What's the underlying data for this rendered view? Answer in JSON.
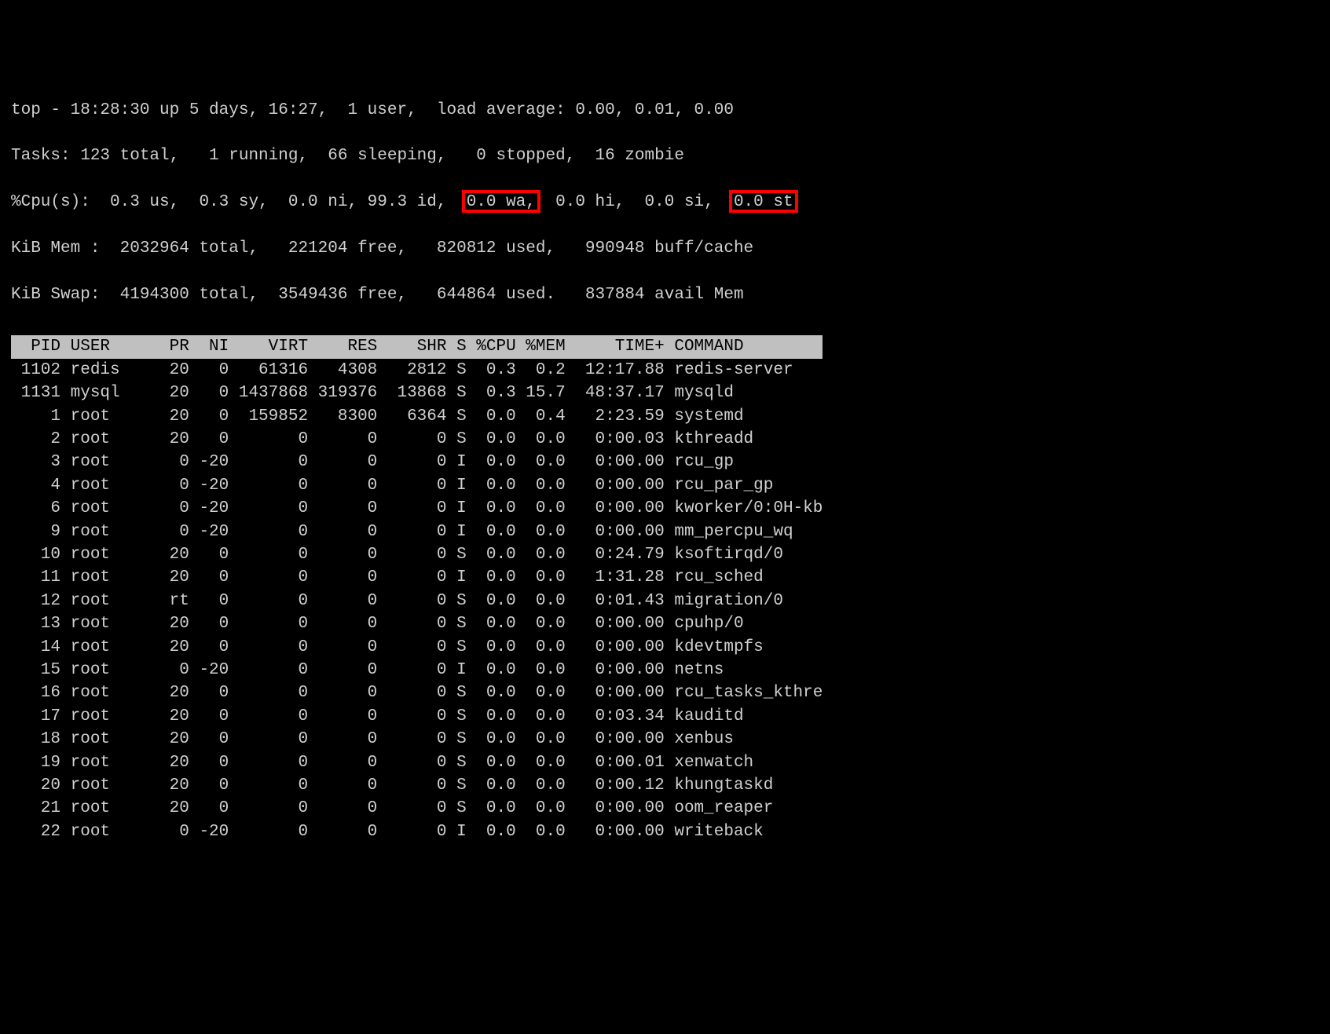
{
  "top_header": {
    "line1": "top - 18:28:30 up 5 days, 16:27,  1 user,  load average: 0.00, 0.01, 0.00",
    "line2": "Tasks: 123 total,   1 running,  66 sleeping,   0 stopped,  16 zombie",
    "line3": "%Cpu(s):  0.3 us,  0.3 sy,  0.0 ni, 99.3 id,  0.0 wa,  0.0 hi,  0.0 si,  0.0 st",
    "line4": "KiB Mem :  2032964 total,   221204 free,   820812 used,   990948 buff/cache",
    "line5": "KiB Swap:  4194300 total,  3549436 free,   644864 used.   837884 avail Mem"
  },
  "columns_header": "  PID USER      PR  NI    VIRT    RES    SHR S %CPU %MEM     TIME+ COMMAND        ",
  "processes": [
    {
      "row": " 1102 redis     20   0   61316   4308   2812 S  0.3  0.2  12:17.88 redis-server",
      "pid": 1102,
      "user": "redis",
      "pr": "20",
      "ni": "0",
      "virt": "61316",
      "res": "4308",
      "shr": "2812",
      "s": "S",
      "cpu": "0.3",
      "mem": "0.2",
      "time": "12:17.88",
      "command": "redis-server"
    },
    {
      "row": " 1131 mysql     20   0 1437868 319376  13868 S  0.3 15.7  48:37.17 mysqld",
      "pid": 1131,
      "user": "mysql",
      "pr": "20",
      "ni": "0",
      "virt": "1437868",
      "res": "319376",
      "shr": "13868",
      "s": "S",
      "cpu": "0.3",
      "mem": "15.7",
      "time": "48:37.17",
      "command": "mysqld"
    },
    {
      "row": "    1 root      20   0  159852   8300   6364 S  0.0  0.4   2:23.59 systemd",
      "pid": 1,
      "user": "root",
      "pr": "20",
      "ni": "0",
      "virt": "159852",
      "res": "8300",
      "shr": "6364",
      "s": "S",
      "cpu": "0.0",
      "mem": "0.4",
      "time": "2:23.59",
      "command": "systemd"
    },
    {
      "row": "    2 root      20   0       0      0      0 S  0.0  0.0   0:00.03 kthreadd",
      "pid": 2,
      "user": "root",
      "pr": "20",
      "ni": "0",
      "virt": "0",
      "res": "0",
      "shr": "0",
      "s": "S",
      "cpu": "0.0",
      "mem": "0.0",
      "time": "0:00.03",
      "command": "kthreadd"
    },
    {
      "row": "    3 root       0 -20       0      0      0 I  0.0  0.0   0:00.00 rcu_gp",
      "pid": 3,
      "user": "root",
      "pr": "0",
      "ni": "-20",
      "virt": "0",
      "res": "0",
      "shr": "0",
      "s": "I",
      "cpu": "0.0",
      "mem": "0.0",
      "time": "0:00.00",
      "command": "rcu_gp"
    },
    {
      "row": "    4 root       0 -20       0      0      0 I  0.0  0.0   0:00.00 rcu_par_gp",
      "pid": 4,
      "user": "root",
      "pr": "0",
      "ni": "-20",
      "virt": "0",
      "res": "0",
      "shr": "0",
      "s": "I",
      "cpu": "0.0",
      "mem": "0.0",
      "time": "0:00.00",
      "command": "rcu_par_gp"
    },
    {
      "row": "    6 root       0 -20       0      0      0 I  0.0  0.0   0:00.00 kworker/0:0H-kb",
      "pid": 6,
      "user": "root",
      "pr": "0",
      "ni": "-20",
      "virt": "0",
      "res": "0",
      "shr": "0",
      "s": "I",
      "cpu": "0.0",
      "mem": "0.0",
      "time": "0:00.00",
      "command": "kworker/0:0H-kb"
    },
    {
      "row": "    9 root       0 -20       0      0      0 I  0.0  0.0   0:00.00 mm_percpu_wq",
      "pid": 9,
      "user": "root",
      "pr": "0",
      "ni": "-20",
      "virt": "0",
      "res": "0",
      "shr": "0",
      "s": "I",
      "cpu": "0.0",
      "mem": "0.0",
      "time": "0:00.00",
      "command": "mm_percpu_wq"
    },
    {
      "row": "   10 root      20   0       0      0      0 S  0.0  0.0   0:24.79 ksoftirqd/0",
      "pid": 10,
      "user": "root",
      "pr": "20",
      "ni": "0",
      "virt": "0",
      "res": "0",
      "shr": "0",
      "s": "S",
      "cpu": "0.0",
      "mem": "0.0",
      "time": "0:24.79",
      "command": "ksoftirqd/0"
    },
    {
      "row": "   11 root      20   0       0      0      0 I  0.0  0.0   1:31.28 rcu_sched",
      "pid": 11,
      "user": "root",
      "pr": "20",
      "ni": "0",
      "virt": "0",
      "res": "0",
      "shr": "0",
      "s": "I",
      "cpu": "0.0",
      "mem": "0.0",
      "time": "1:31.28",
      "command": "rcu_sched"
    },
    {
      "row": "   12 root      rt   0       0      0      0 S  0.0  0.0   0:01.43 migration/0",
      "pid": 12,
      "user": "root",
      "pr": "rt",
      "ni": "0",
      "virt": "0",
      "res": "0",
      "shr": "0",
      "s": "S",
      "cpu": "0.0",
      "mem": "0.0",
      "time": "0:01.43",
      "command": "migration/0"
    },
    {
      "row": "   13 root      20   0       0      0      0 S  0.0  0.0   0:00.00 cpuhp/0",
      "pid": 13,
      "user": "root",
      "pr": "20",
      "ni": "0",
      "virt": "0",
      "res": "0",
      "shr": "0",
      "s": "S",
      "cpu": "0.0",
      "mem": "0.0",
      "time": "0:00.00",
      "command": "cpuhp/0"
    },
    {
      "row": "   14 root      20   0       0      0      0 S  0.0  0.0   0:00.00 kdevtmpfs",
      "pid": 14,
      "user": "root",
      "pr": "20",
      "ni": "0",
      "virt": "0",
      "res": "0",
      "shr": "0",
      "s": "S",
      "cpu": "0.0",
      "mem": "0.0",
      "time": "0:00.00",
      "command": "kdevtmpfs"
    },
    {
      "row": "   15 root       0 -20       0      0      0 I  0.0  0.0   0:00.00 netns",
      "pid": 15,
      "user": "root",
      "pr": "0",
      "ni": "-20",
      "virt": "0",
      "res": "0",
      "shr": "0",
      "s": "I",
      "cpu": "0.0",
      "mem": "0.0",
      "time": "0:00.00",
      "command": "netns"
    },
    {
      "row": "   16 root      20   0       0      0      0 S  0.0  0.0   0:00.00 rcu_tasks_kthre",
      "pid": 16,
      "user": "root",
      "pr": "20",
      "ni": "0",
      "virt": "0",
      "res": "0",
      "shr": "0",
      "s": "S",
      "cpu": "0.0",
      "mem": "0.0",
      "time": "0:00.00",
      "command": "rcu_tasks_kthre"
    },
    {
      "row": "   17 root      20   0       0      0      0 S  0.0  0.0   0:03.34 kauditd",
      "pid": 17,
      "user": "root",
      "pr": "20",
      "ni": "0",
      "virt": "0",
      "res": "0",
      "shr": "0",
      "s": "S",
      "cpu": "0.0",
      "mem": "0.0",
      "time": "0:03.34",
      "command": "kauditd"
    },
    {
      "row": "   18 root      20   0       0      0      0 S  0.0  0.0   0:00.00 xenbus",
      "pid": 18,
      "user": "root",
      "pr": "20",
      "ni": "0",
      "virt": "0",
      "res": "0",
      "shr": "0",
      "s": "S",
      "cpu": "0.0",
      "mem": "0.0",
      "time": "0:00.00",
      "command": "xenbus"
    },
    {
      "row": "   19 root      20   0       0      0      0 S  0.0  0.0   0:00.01 xenwatch",
      "pid": 19,
      "user": "root",
      "pr": "20",
      "ni": "0",
      "virt": "0",
      "res": "0",
      "shr": "0",
      "s": "S",
      "cpu": "0.0",
      "mem": "0.0",
      "time": "0:00.01",
      "command": "xenwatch"
    },
    {
      "row": "   20 root      20   0       0      0      0 S  0.0  0.0   0:00.12 khungtaskd",
      "pid": 20,
      "user": "root",
      "pr": "20",
      "ni": "0",
      "virt": "0",
      "res": "0",
      "shr": "0",
      "s": "S",
      "cpu": "0.0",
      "mem": "0.0",
      "time": "0:00.12",
      "command": "khungtaskd"
    },
    {
      "row": "   21 root      20   0       0      0      0 S  0.0  0.0   0:00.00 oom_reaper",
      "pid": 21,
      "user": "root",
      "pr": "20",
      "ni": "0",
      "virt": "0",
      "res": "0",
      "shr": "0",
      "s": "S",
      "cpu": "0.0",
      "mem": "0.0",
      "time": "0:00.00",
      "command": "oom_reaper"
    },
    {
      "row": "   22 root       0 -20       0      0      0 I  0.0  0.0   0:00.00 writeback",
      "pid": 22,
      "user": "root",
      "pr": "0",
      "ni": "-20",
      "virt": "0",
      "res": "0",
      "shr": "0",
      "s": "I",
      "cpu": "0.0",
      "mem": "0.0",
      "time": "0:00.00",
      "command": "writeback"
    }
  ],
  "highlights": {
    "wa_text": "0.0 wa,",
    "st_text": "0.0 st"
  }
}
